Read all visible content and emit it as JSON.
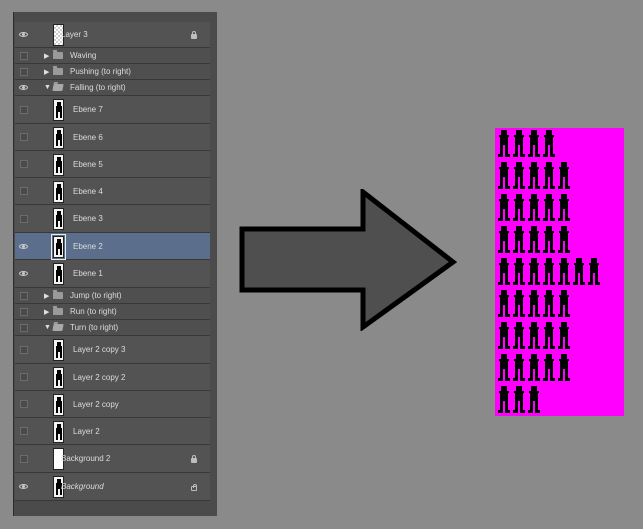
{
  "layers_panel": {
    "rows": [
      {
        "kind": "layer",
        "label": "Layer 3",
        "visible": true,
        "thumb": "transparent",
        "locked": true
      },
      {
        "kind": "group",
        "label": "Waving",
        "visible": false,
        "expanded": false
      },
      {
        "kind": "group",
        "label": "Pushing (to right)",
        "visible": false,
        "expanded": false
      },
      {
        "kind": "group",
        "label": "Falling (to right)",
        "visible": true,
        "expanded": true
      },
      {
        "kind": "layer",
        "label": "Ebene 7",
        "visible": false,
        "thumb": "sprite"
      },
      {
        "kind": "layer",
        "label": "Ebene 6",
        "visible": false,
        "thumb": "sprite"
      },
      {
        "kind": "layer",
        "label": "Ebene 5",
        "visible": false,
        "thumb": "sprite"
      },
      {
        "kind": "layer",
        "label": "Ebene 4",
        "visible": false,
        "thumb": "sprite"
      },
      {
        "kind": "layer",
        "label": "Ebene 3",
        "visible": false,
        "thumb": "sprite"
      },
      {
        "kind": "layer",
        "label": "Ebene 2",
        "visible": true,
        "thumb": "sprite",
        "selected": true
      },
      {
        "kind": "layer",
        "label": "Ebene 1",
        "visible": true,
        "thumb": "sprite"
      },
      {
        "kind": "group",
        "label": "Jump (to right)",
        "visible": false,
        "expanded": false
      },
      {
        "kind": "group",
        "label": "Run (to right)",
        "visible": false,
        "expanded": false
      },
      {
        "kind": "group",
        "label": "Turn (to right)",
        "visible": false,
        "expanded": true
      },
      {
        "kind": "layer",
        "label": "Layer 2 copy 3",
        "visible": false,
        "thumb": "sprite"
      },
      {
        "kind": "layer",
        "label": "Layer 2 copy 2",
        "visible": false,
        "thumb": "sprite"
      },
      {
        "kind": "layer",
        "label": "Layer 2 copy",
        "visible": false,
        "thumb": "sprite"
      },
      {
        "kind": "layer",
        "label": "Layer 2",
        "visible": false,
        "thumb": "sprite"
      },
      {
        "kind": "layer",
        "label": "Background 2",
        "visible": false,
        "thumb": "white",
        "locked": true
      },
      {
        "kind": "layer",
        "label": "Background",
        "visible": true,
        "thumb": "sprite",
        "locked": true,
        "italic": true
      }
    ]
  },
  "sprite_sheet": {
    "background_color": "#ff00ff",
    "figure_color": "#000000",
    "rows": 9,
    "columns": 5
  },
  "colors": {
    "page_bg": "#8a8a8a",
    "panel_bg": "#4b4b4b",
    "row_bg": "#535353",
    "selected_row": "#5b6f8d",
    "arrow_fill": "#4f4f4f",
    "arrow_stroke": "#000000"
  }
}
